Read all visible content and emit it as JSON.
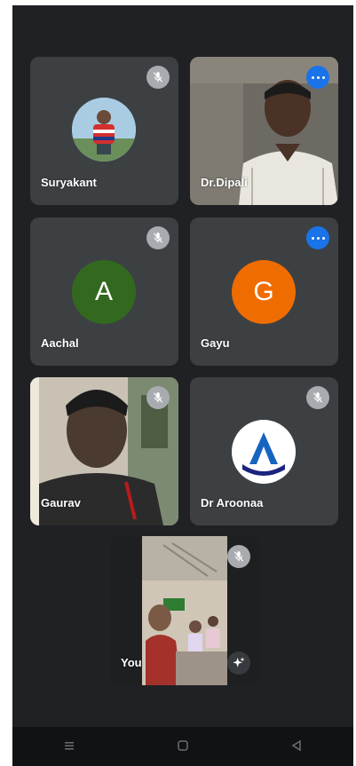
{
  "participants": [
    {
      "name": "Suryakant",
      "avatar": "photo",
      "status": "muted"
    },
    {
      "name": "Dr.Dipali",
      "avatar": "video",
      "status": "speaking"
    },
    {
      "name": "Aachal",
      "avatar": "A",
      "avatar_color": "#33691e",
      "status": "muted"
    },
    {
      "name": "Gayu",
      "avatar": "G",
      "avatar_color": "#ef6c00",
      "status": "speaking"
    },
    {
      "name": "Gaurav",
      "avatar": "video",
      "status": "muted"
    },
    {
      "name": "Dr Aroonaa",
      "avatar": "logo",
      "status": "muted"
    },
    {
      "name": "You",
      "avatar": "video",
      "status": "muted"
    }
  ],
  "icons": {
    "mute": "mic-off-icon",
    "more": "more-options-icon",
    "effects": "sparkle-effects-icon",
    "nav_recent": "recent-apps-icon",
    "nav_home": "home-icon",
    "nav_back": "back-icon"
  },
  "colors": {
    "background": "#202124",
    "tile": "#3c4043",
    "speaking_indicator": "#1a73e8"
  }
}
